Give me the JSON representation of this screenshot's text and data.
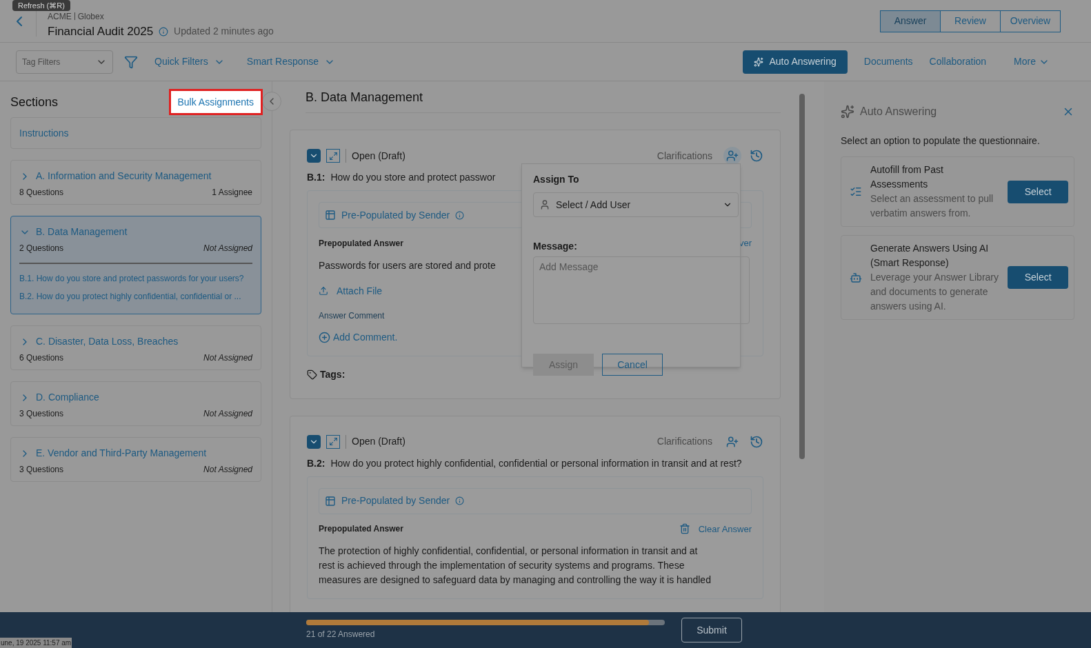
{
  "tooltip": "Refresh (⌘R)",
  "header": {
    "org": "ACME",
    "client": "Globex",
    "title": "Financial Audit 2025",
    "updated": "Updated 2 minutes ago"
  },
  "view_tabs": [
    {
      "label": "Answer",
      "selected": true
    },
    {
      "label": "Review",
      "selected": false
    },
    {
      "label": "Overview",
      "selected": false
    }
  ],
  "toolbar": {
    "tag_filter_placeholder": "Tag Filters",
    "quick_filters": "Quick Filters",
    "smart_response": "Smart Response",
    "auto_answering": "Auto Answering",
    "links": [
      "Documents",
      "Collaboration"
    ],
    "more": "More"
  },
  "sections_panel": {
    "title": "Sections",
    "bulk_assignments": "Bulk Assignments",
    "instructions": "Instructions",
    "sections": [
      {
        "title": "A. Information and Security Management",
        "count": "8 Questions",
        "assignee": "1 Assignee",
        "assigned": true,
        "expanded": false,
        "selected": false
      },
      {
        "title": "B. Data Management",
        "count": "2 Questions",
        "assignee": "Not Assigned",
        "assigned": false,
        "expanded": true,
        "selected": true,
        "questions": [
          "B.1. How do you store and protect passwords for your users?",
          "B.2. How do you protect highly confidential, confidential or ..."
        ]
      },
      {
        "title": "C. Disaster, Data Loss, Breaches",
        "count": "6 Questions",
        "assignee": "Not Assigned",
        "assigned": false,
        "expanded": false,
        "selected": false
      },
      {
        "title": "D. Compliance",
        "count": "3 Questions",
        "assignee": "Not Assigned",
        "assigned": false,
        "expanded": false,
        "selected": false
      },
      {
        "title": "E. Vendor and Third-Party Management",
        "count": "3 Questions",
        "assignee": "Not Assigned",
        "assigned": false,
        "expanded": false,
        "selected": false
      }
    ]
  },
  "main": {
    "title": "B. Data Management",
    "questions": [
      {
        "status": "Open (Draft)",
        "clarifications": "Clarifications",
        "number": "B.1:",
        "text": "How do you store and protect passwor",
        "prepopulated": "Pre-Populated by Sender",
        "answer_label": "Prepopulated Answer",
        "clear": "ver",
        "answer": [
          "Passwords for users are stored and prote"
        ],
        "attach": "Attach File",
        "comment_label": "Answer Comment",
        "add_comment": "Add Comment.",
        "tags": "Tags:"
      },
      {
        "status": "Open (Draft)",
        "clarifications": "Clarifications",
        "number": "B.2:",
        "text": "How do you protect highly confidential, confidential or personal information in transit and at rest?",
        "prepopulated": "Pre-Populated by Sender",
        "answer_label": "Prepopulated Answer",
        "clear": "Clear Answer",
        "answer": [
          "The protection of highly confidential, confidential, or personal information in transit and at",
          "rest is achieved through the implementation of security systems and programs. These",
          "measures are designed to safeguard data by managing and controlling the way it is handled"
        ]
      }
    ]
  },
  "assign_popup": {
    "title": "Assign To",
    "user_placeholder": "Select / Add User",
    "message_label": "Message:",
    "message_placeholder": "Add Message",
    "assign": "Assign",
    "assign_disabled": true,
    "cancel": "Cancel"
  },
  "auto_panel": {
    "title": "Auto Answering",
    "description": "Select an option to populate the questionnaire.",
    "options": [
      {
        "kind": "list",
        "title": "Autofill from Past Assessments",
        "description": "Select an assessment to pull verbatim answers from.",
        "button": "Select"
      },
      {
        "kind": "robot",
        "title": "Generate Answers Using AI (Smart Response)",
        "description": "Leverage your Answer Library and documents to generate answers using AI.",
        "button": "Select"
      }
    ]
  },
  "footer": {
    "timestamp": "une, 19 2025 11:57 am",
    "progress": {
      "level": 0.955,
      "label": "21 of 22 Answered"
    },
    "submit": "Submit"
  }
}
